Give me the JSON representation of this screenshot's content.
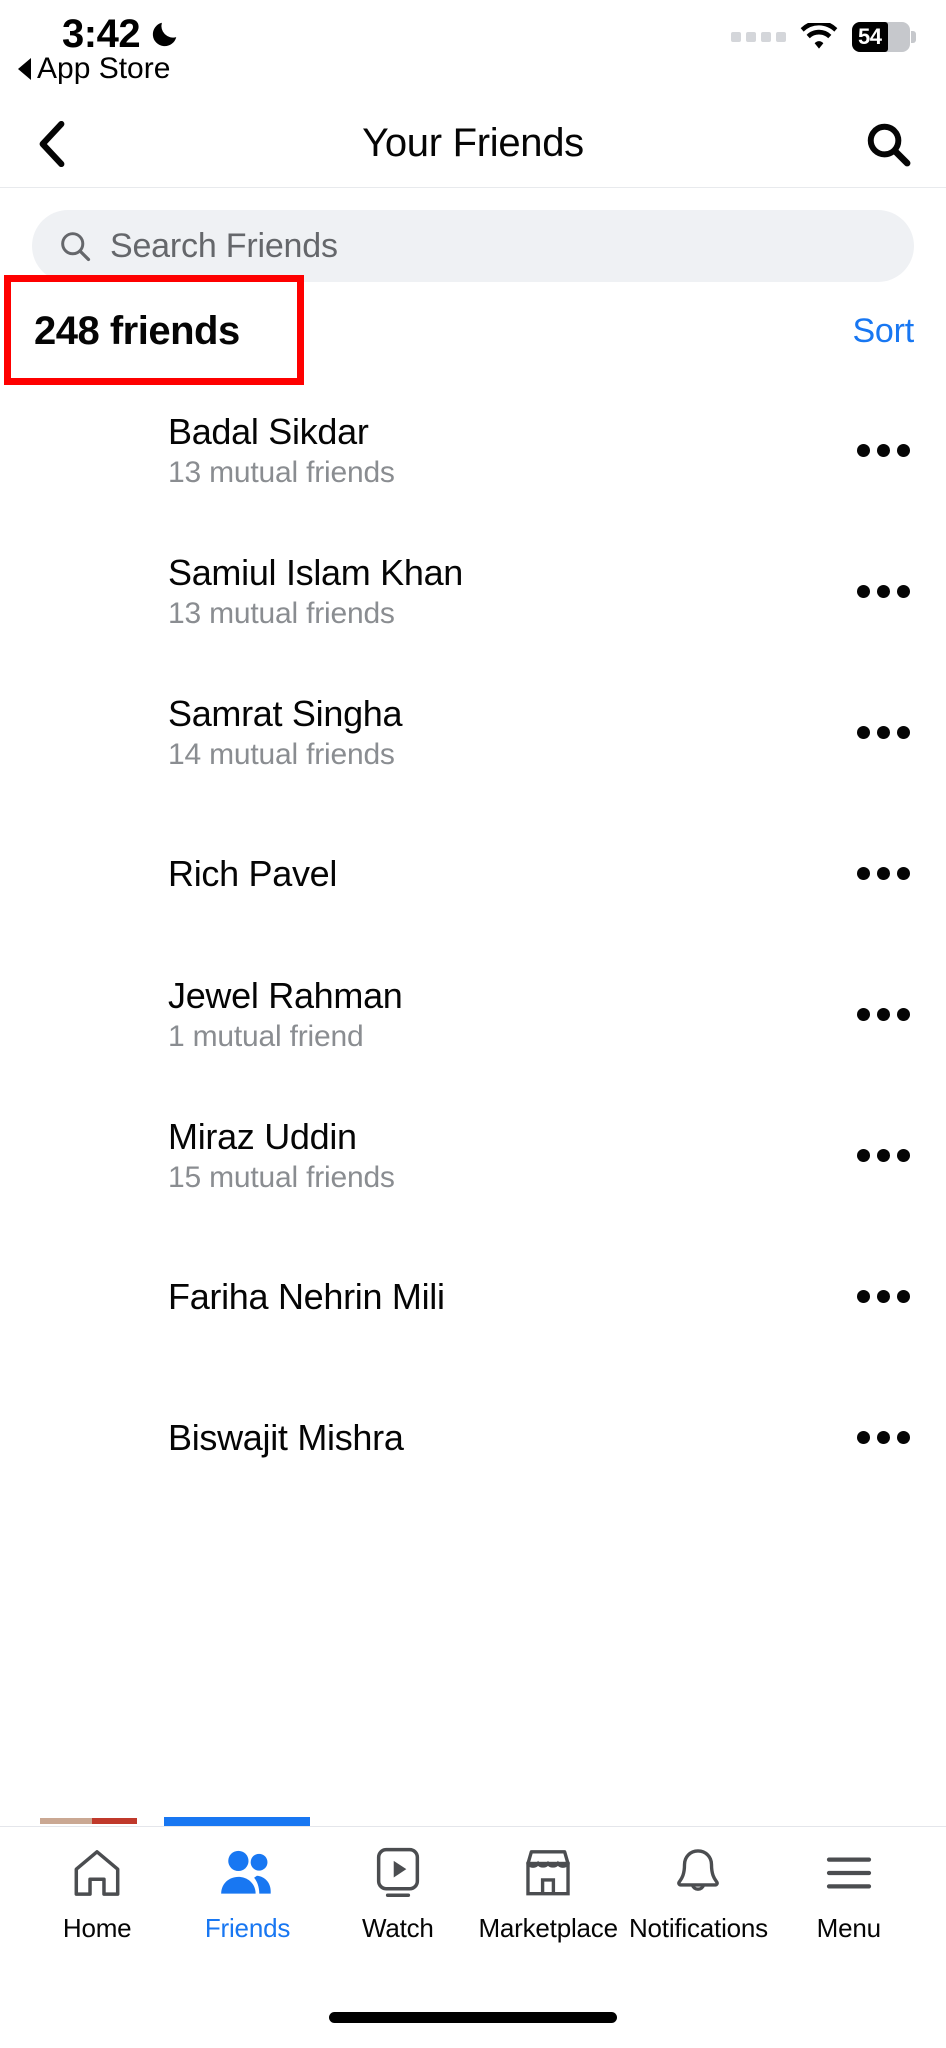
{
  "status_bar": {
    "time": "3:42",
    "moon_icon": "crescent-moon-icon",
    "back_app_label": "App Store",
    "signal_icon": "signal-dots-icon",
    "wifi_icon": "wifi-icon",
    "battery_level": "54"
  },
  "nav": {
    "back_icon": "chevron-left-icon",
    "title": "Your Friends",
    "search_icon": "search-icon"
  },
  "search": {
    "icon": "search-icon",
    "placeholder": "Search Friends",
    "value": ""
  },
  "count_row": {
    "count_label": "248 friends",
    "sort_label": "Sort",
    "annotation_color": "#fe0000"
  },
  "friends": [
    {
      "name": "Badal Sikdar",
      "mutual": "13 mutual friends"
    },
    {
      "name": "Samiul Islam Khan",
      "mutual": "13 mutual friends"
    },
    {
      "name": "Samrat Singha",
      "mutual": "14 mutual friends"
    },
    {
      "name": "Rich Pavel",
      "mutual": ""
    },
    {
      "name": "Jewel Rahman",
      "mutual": "1 mutual friend"
    },
    {
      "name": "Miraz Uddin",
      "mutual": "15 mutual friends"
    },
    {
      "name": "Fariha Nehrin Mili",
      "mutual": ""
    },
    {
      "name": "Biswajit Mishra",
      "mutual": ""
    }
  ],
  "row_menu_icon": "ellipsis-icon",
  "tabs": [
    {
      "label": "Home",
      "icon": "home-icon",
      "active": false
    },
    {
      "label": "Friends",
      "icon": "friends-icon",
      "active": true
    },
    {
      "label": "Watch",
      "icon": "watch-icon",
      "active": false
    },
    {
      "label": "Marketplace",
      "icon": "marketplace-icon",
      "active": false
    },
    {
      "label": "Notifications",
      "icon": "bell-icon",
      "active": false
    },
    {
      "label": "Menu",
      "icon": "hamburger-menu-icon",
      "active": false
    }
  ],
  "theme": {
    "accent_blue": "#1877f2",
    "text_primary": "#050505",
    "text_secondary": "#8a8d91",
    "search_bg": "#eff1f4"
  }
}
